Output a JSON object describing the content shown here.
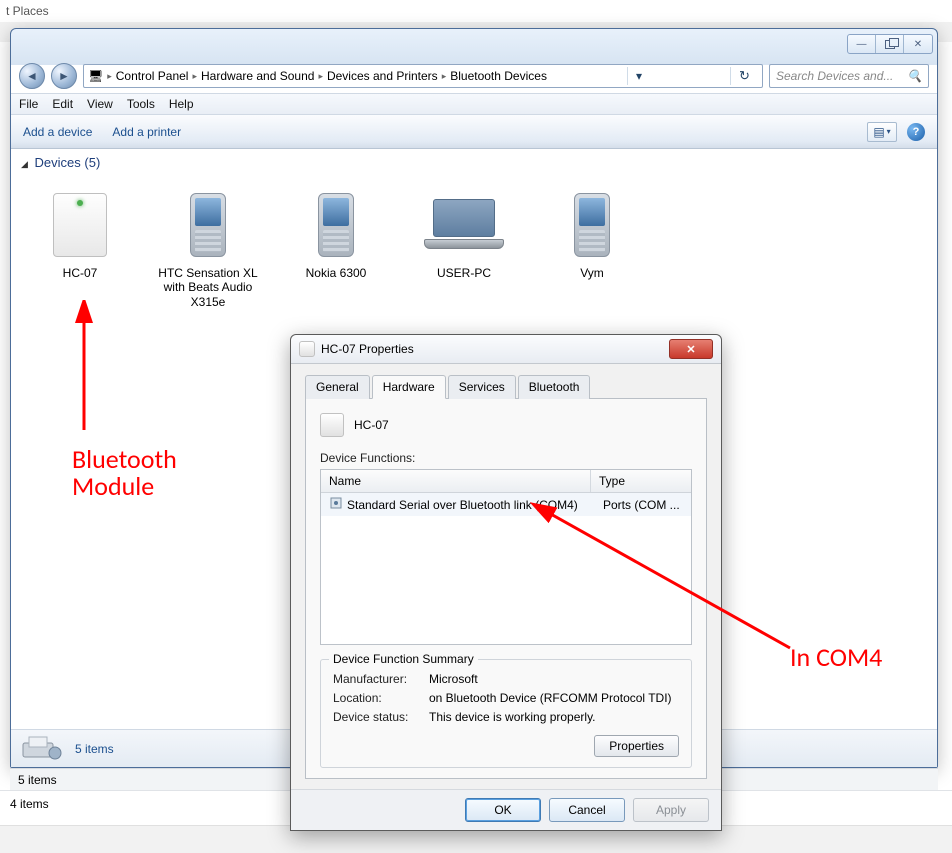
{
  "backdrop": {
    "places": "t Places"
  },
  "window": {
    "controls": {
      "min": "—",
      "close": "✕"
    },
    "nav_back": "◄",
    "nav_fwd": "►"
  },
  "breadcrumbs": {
    "root_icon": "🖥",
    "items": [
      "Control Panel",
      "Hardware and Sound",
      "Devices and Printers",
      "Bluetooth Devices"
    ]
  },
  "search": {
    "placeholder": "Search Devices and...",
    "icon": "🔍"
  },
  "menu": [
    "File",
    "Edit",
    "View",
    "Tools",
    "Help"
  ],
  "toolbar": {
    "add_device": "Add a device",
    "add_printer": "Add a printer",
    "view_icon": "▾",
    "help": "?"
  },
  "group": {
    "title": "Devices (5)",
    "triangle": "◢"
  },
  "devices": [
    {
      "name": "HC-07"
    },
    {
      "name": "HTC Sensation XL with Beats Audio X315e"
    },
    {
      "name": "Nokia 6300"
    },
    {
      "name": "USER-PC"
    },
    {
      "name": "Vym"
    }
  ],
  "bottom_bar": {
    "text": "5 items"
  },
  "status_inner": "5 items",
  "status_outer": "4 items",
  "dialog": {
    "title": "HC-07 Properties",
    "close": "✕",
    "tabs": [
      "General",
      "Hardware",
      "Services",
      "Bluetooth"
    ],
    "active_tab": 1,
    "device_name": "HC-07",
    "functions_label": "Device Functions:",
    "columns": {
      "name": "Name",
      "type": "Type"
    },
    "rows": [
      {
        "name": "Standard Serial over Bluetooth link (COM4)",
        "type": "Ports (COM ..."
      }
    ],
    "summary": {
      "legend": "Device Function Summary",
      "manufacturer_k": "Manufacturer:",
      "manufacturer_v": "Microsoft",
      "location_k": "Location:",
      "location_v": "on Bluetooth Device (RFCOMM Protocol TDI)",
      "status_k": "Device status:",
      "status_v": "This device is working properly."
    },
    "props_btn": "Properties",
    "buttons": {
      "ok": "OK",
      "cancel": "Cancel",
      "apply": "Apply"
    }
  },
  "annotations": {
    "bt_module": "Bluetooth\nModule",
    "in_com4": "In COM4"
  }
}
